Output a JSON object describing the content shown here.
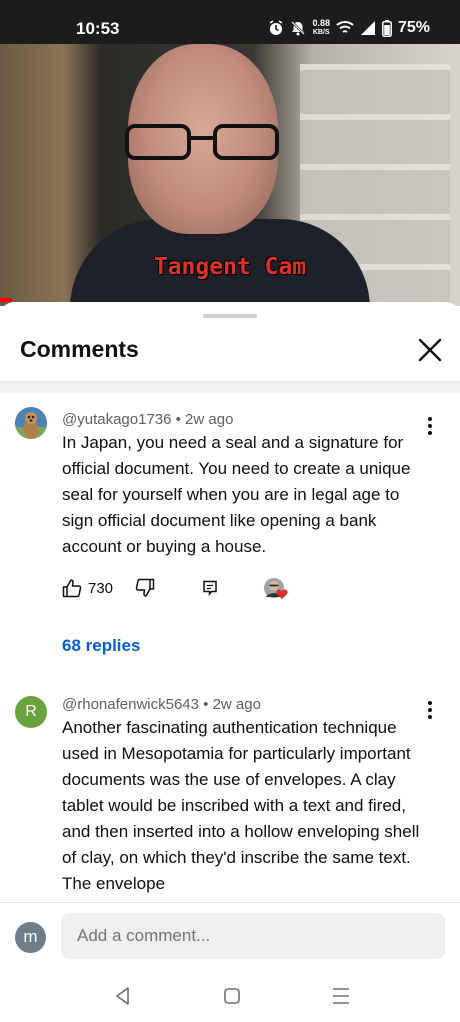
{
  "status": {
    "time": "10:53",
    "net_speed_value": "0.88",
    "net_speed_unit": "KB/S",
    "battery": "75%",
    "icons": [
      "alarm-icon",
      "mute-icon",
      "wifi-icon",
      "signal-icon",
      "battery-icon"
    ]
  },
  "video": {
    "caption": "Tangent Cam",
    "progress_fraction": 0.026
  },
  "sheet": {
    "title": "Comments"
  },
  "comments": [
    {
      "author": "@yutakago1736",
      "age": "2w ago",
      "meta": "@yutakago1736 • 2w ago",
      "text": "In Japan, you need a seal and a signature for official document. You need to create a unique seal for yourself when you are in legal age to sign official document like opening a bank account or buying a house.",
      "likes": "730",
      "replies": "68 replies",
      "avatar_icon": "meerkat-avatar-icon",
      "creator_heart_icon": "creator-heart-icon"
    },
    {
      "author": "@rhonafenwick5643",
      "age": "2w ago",
      "meta": "@rhonafenwick5643 • 2w ago",
      "avatar_letter": "R",
      "text": "Another fascinating authentication technique used in Mesopotamia for particularly important documents was the use of envelopes. A clay tablet would be inscribed with a text and fired, and then inserted into a hollow enveloping shell of clay, on which they'd inscribe the same text. The envelope"
    }
  ],
  "composer": {
    "avatar_letter": "m",
    "placeholder": "Add a comment..."
  },
  "colors": {
    "link_blue": "#065fd4",
    "heart_red": "#e5282a",
    "caption_red": "#e0302a",
    "avatar_green": "#6aa33e",
    "me_avatar": "#6d7e89"
  }
}
